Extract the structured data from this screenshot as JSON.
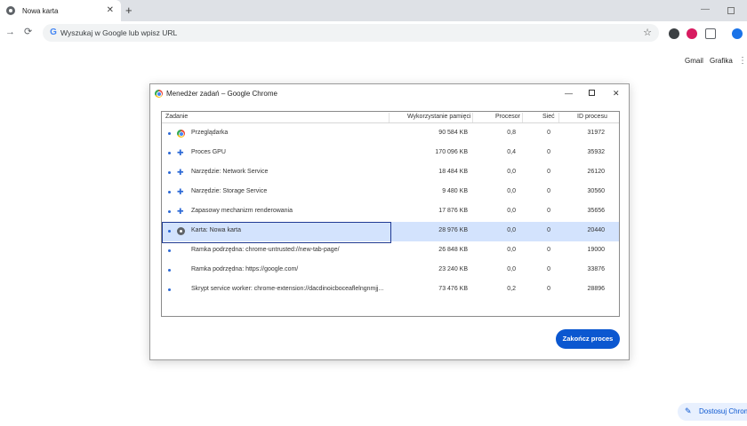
{
  "browser": {
    "tab_title": "Nowa karta",
    "tab_close": "✕",
    "new_tab": "+",
    "omnibox_placeholder": "Wyszukaj w Google lub wpisz URL",
    "back": "←",
    "forward": "→",
    "reload": "⟳",
    "star": "☆"
  },
  "ntp": {
    "gmail": "Gmail",
    "images": "Grafika",
    "customize": "Dostosuj Chrome"
  },
  "task_manager": {
    "title": "Menedżer zadań – Google Chrome",
    "columns": {
      "task": "Zadanie",
      "memory": "Wykorzystanie pamięci",
      "cpu": "Procesor",
      "network": "Sieć",
      "pid": "ID procesu"
    },
    "rows": [
      {
        "icon": "chrome-icon",
        "name": "Przeglądarka",
        "memory": "90 584 KB",
        "cpu": "0,8",
        "network": "0",
        "pid": "31972"
      },
      {
        "icon": "puzzle-icon",
        "name": "Proces GPU",
        "memory": "170 096 KB",
        "cpu": "0,4",
        "network": "0",
        "pid": "35932"
      },
      {
        "icon": "puzzle-icon",
        "name": "Narzędzie: Network Service",
        "memory": "18 484 KB",
        "cpu": "0,0",
        "network": "0",
        "pid": "26120"
      },
      {
        "icon": "puzzle-icon",
        "name": "Narzędzie: Storage Service",
        "memory": "9 480 KB",
        "cpu": "0,0",
        "network": "0",
        "pid": "30560"
      },
      {
        "icon": "puzzle-icon",
        "name": "Zapasowy mechanizm renderowania",
        "memory": "17 876 KB",
        "cpu": "0,0",
        "network": "0",
        "pid": "35656"
      },
      {
        "icon": "page-icon",
        "name": "Karta: Nowa karta",
        "memory": "28 976 KB",
        "cpu": "0,0",
        "network": "0",
        "pid": "20440",
        "selected": true
      },
      {
        "icon": "",
        "name": "Ramka podrzędna: chrome-untrusted://new-tab-page/",
        "memory": "26 848 KB",
        "cpu": "0,0",
        "network": "0",
        "pid": "19000"
      },
      {
        "icon": "",
        "name": "Ramka podrzędna: https://google.com/",
        "memory": "23 240 KB",
        "cpu": "0,0",
        "network": "0",
        "pid": "33876"
      },
      {
        "icon": "",
        "name": "Skrypt service worker: chrome-extension://dacdinoicboceaflelngnmjj...",
        "memory": "73 476 KB",
        "cpu": "0,2",
        "network": "0",
        "pid": "28896"
      }
    ],
    "end_process": "Zakończ proces"
  },
  "colors": {
    "accent": "#0b57d0",
    "selection": "#d3e3fd"
  }
}
